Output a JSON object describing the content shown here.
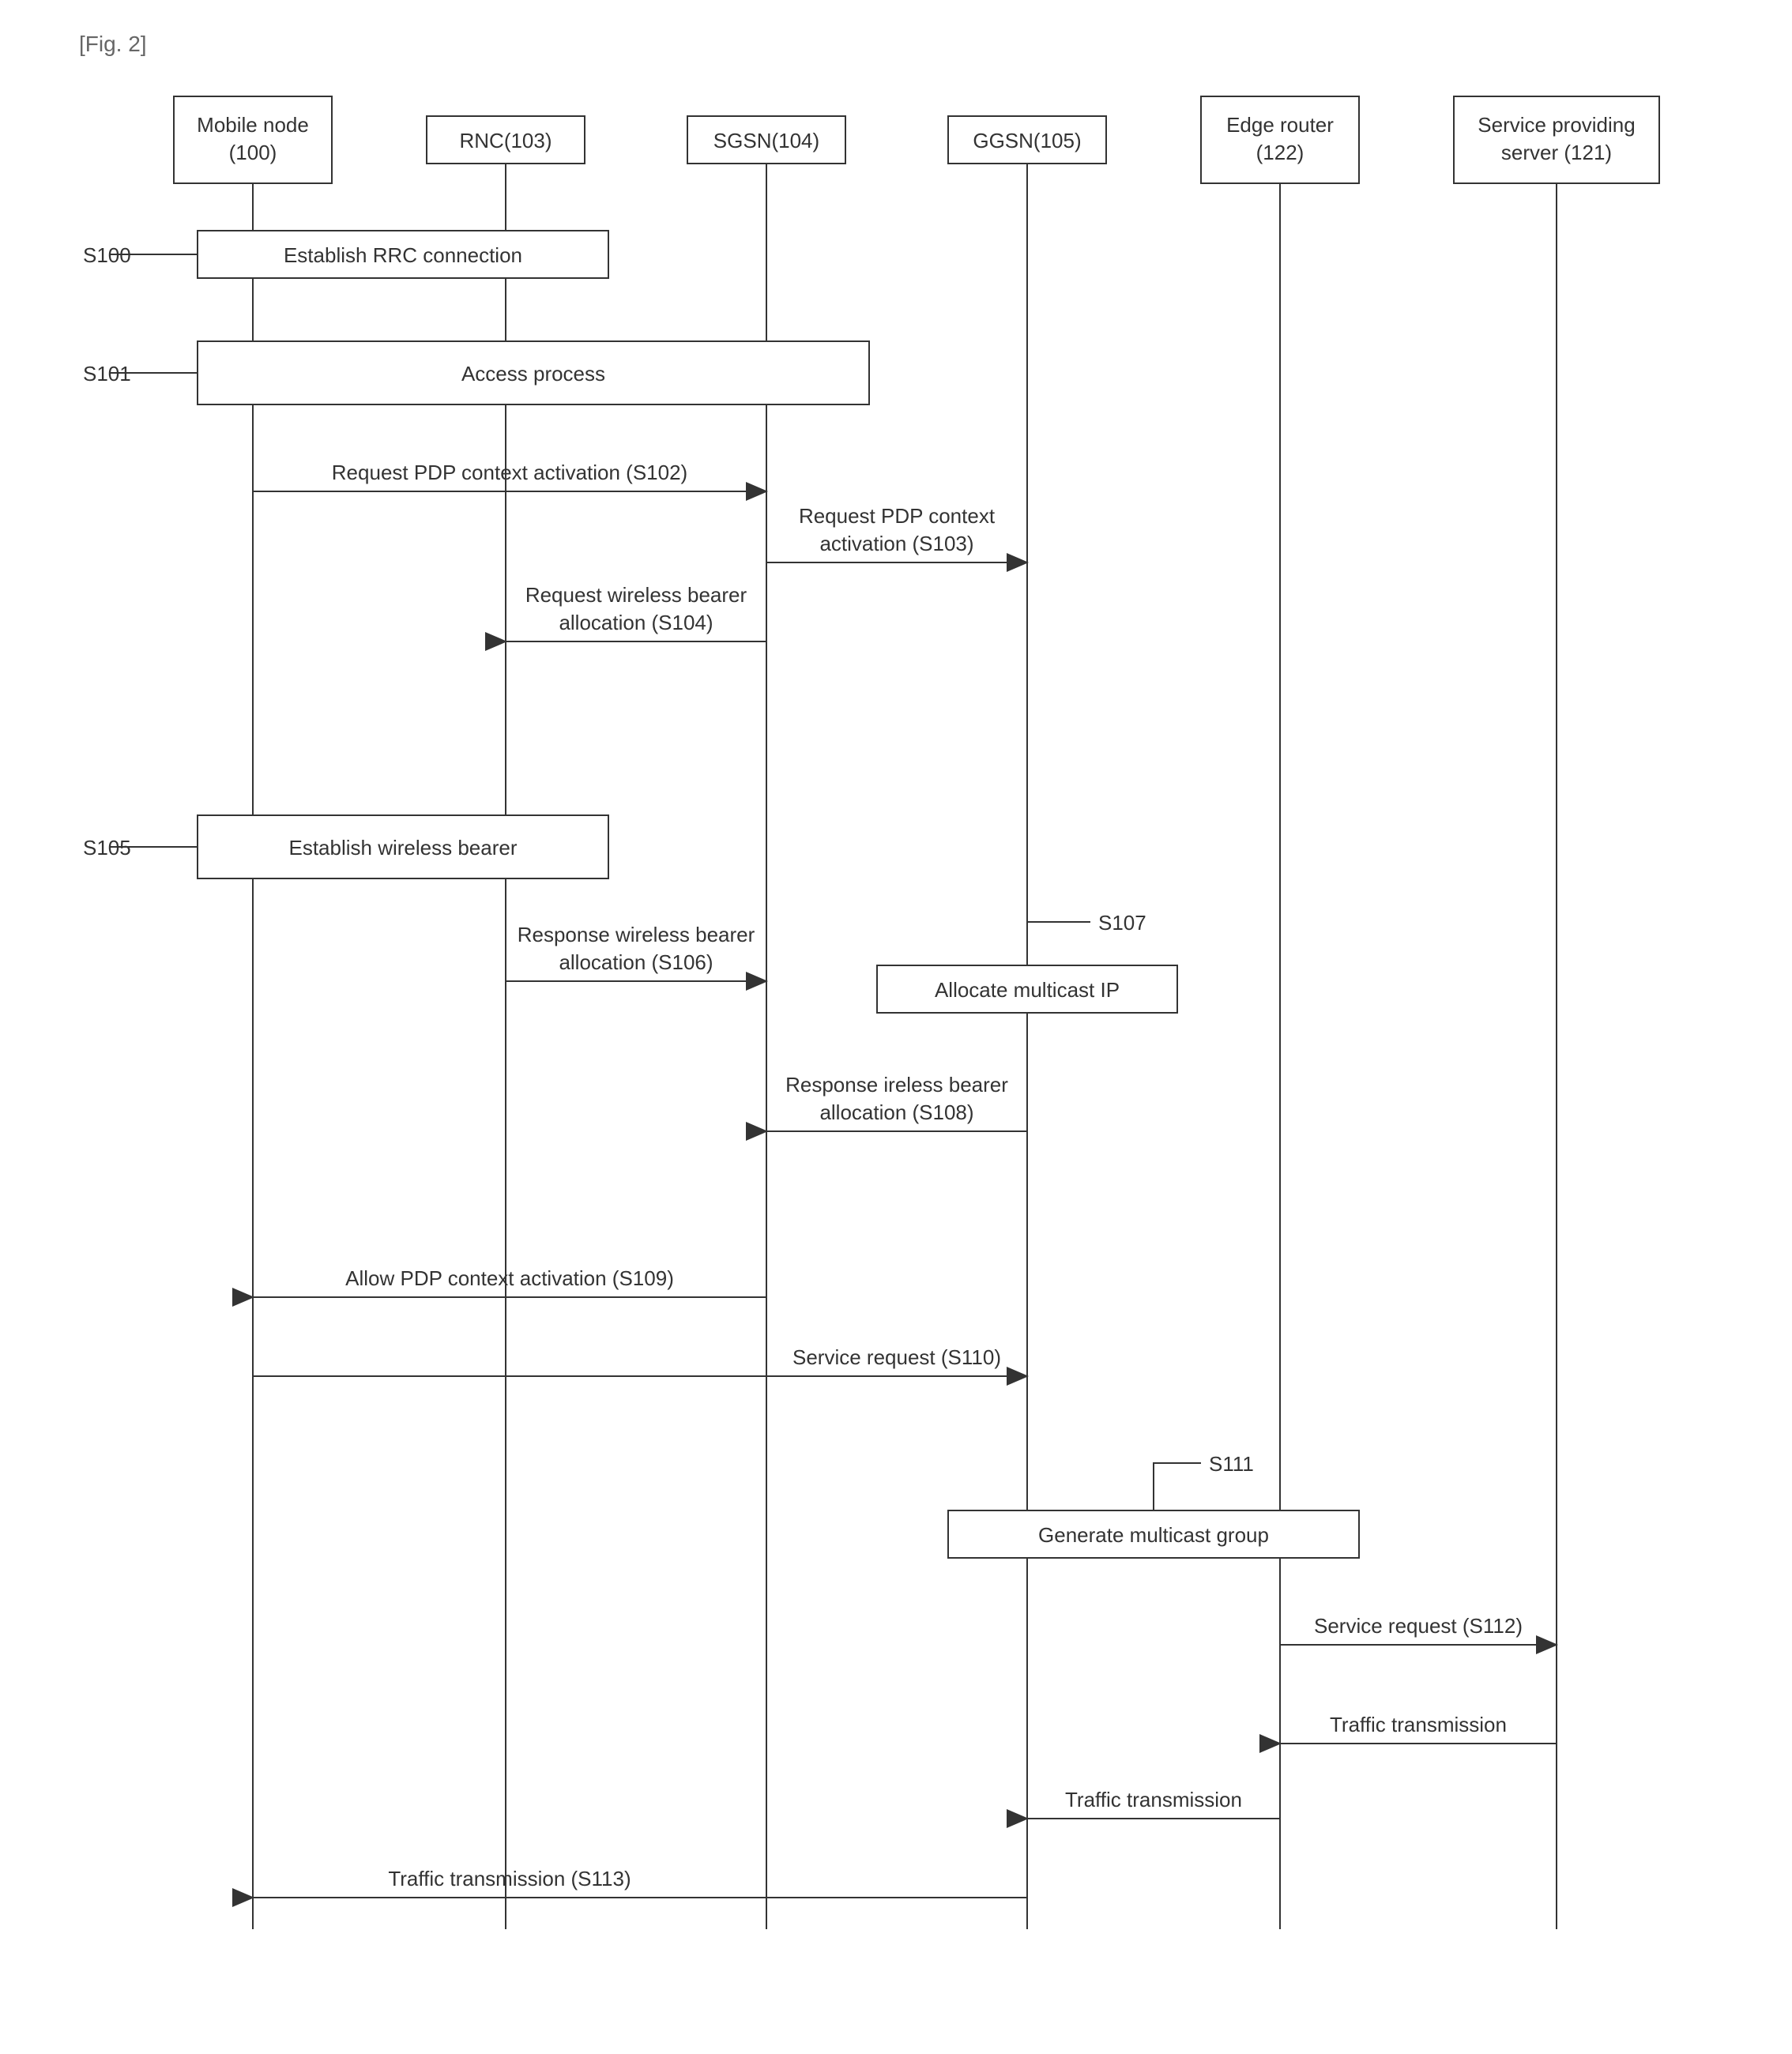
{
  "figure_label": "[Fig. 2]",
  "entities": {
    "mobile_node": {
      "name": "Mobile node",
      "id": "(100)"
    },
    "rnc": {
      "name": "RNC(103)"
    },
    "sgsn": {
      "name": "SGSN(104)"
    },
    "ggsn": {
      "name": "GGSN(105)"
    },
    "edge_router": {
      "name": "Edge router",
      "id": "(122)"
    },
    "service_server": {
      "name": "Service providing",
      "sub": "server (121)"
    }
  },
  "steps": {
    "s100": "S100",
    "s101": "S101",
    "s105": "S105",
    "s107": "S107",
    "s111": "S111"
  },
  "processes": {
    "rrc": "Establish RRC connection",
    "access": "Access process",
    "wireless_bearer": "Establish wireless bearer",
    "allocate_ip": "Allocate multicast IP",
    "multicast_group": "Generate multicast group"
  },
  "messages": {
    "s102": "Request PDP context activation (S102)",
    "s103_l1": "Request PDP context",
    "s103_l2": "activation (S103)",
    "s104_l1": "Request wireless bearer",
    "s104_l2": "allocation (S104)",
    "s106_l1": "Response wireless bearer",
    "s106_l2": "allocation (S106)",
    "s108_l1": "Response ireless bearer",
    "s108_l2": "allocation (S108)",
    "s109": "Allow PDP context activation (S109)",
    "s110": "Service request (S110)",
    "s112": "Service request (S112)",
    "s113_a": "Traffic transmission (S113)",
    "s113_b": "Traffic transmission",
    "s113_c": "Traffic transmission"
  }
}
